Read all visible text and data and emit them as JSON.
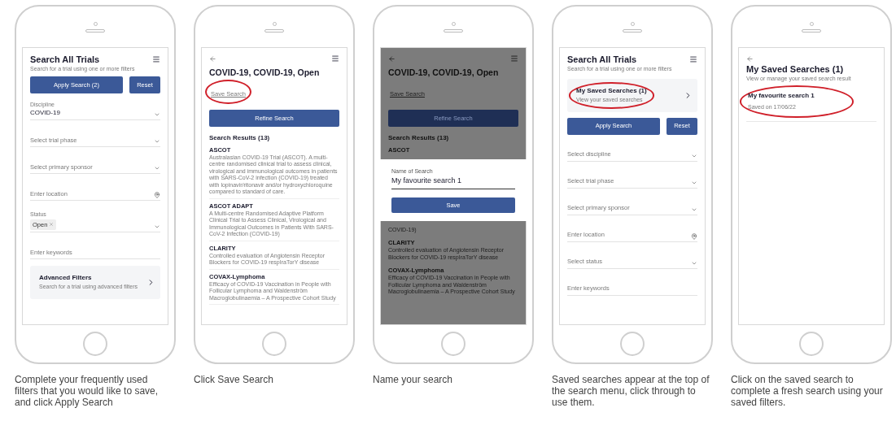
{
  "panels": [
    {
      "dimmed": false,
      "blocks": [
        {
          "kind": "header",
          "title": "Search All Trials",
          "subtitle": "Search for a trial using one or more filters",
          "menu": true
        },
        {
          "kind": "buttons",
          "primary": "Apply Search (2)",
          "secondary": "Reset"
        },
        {
          "kind": "select",
          "label": "Discipline",
          "value": "COVID-19"
        },
        {
          "kind": "select",
          "placeholder": "Select trial phase"
        },
        {
          "kind": "select",
          "placeholder": "Select primary sponsor"
        },
        {
          "kind": "location",
          "placeholder": "Enter location"
        },
        {
          "kind": "chips",
          "label": "Status",
          "chips": [
            "Open"
          ]
        },
        {
          "kind": "input",
          "placeholder": "Enter keywords"
        },
        {
          "kind": "nav_card",
          "title": "Advanced Filters",
          "subtitle": "Search for a trial using advanced filters",
          "circled": false
        }
      ],
      "caption": "Complete your frequently used filters that you would like to save, and click Apply Search"
    },
    {
      "dimmed": false,
      "blocks": [
        {
          "kind": "topbar",
          "menu": true
        },
        {
          "kind": "page_title",
          "title": "COVID-19, COVID-19, Open",
          "link": "Save Search",
          "circled": true
        },
        {
          "kind": "wide_button",
          "label": "Refine Search"
        },
        {
          "kind": "section",
          "label": "Search Results (13)"
        },
        {
          "kind": "result",
          "title": "ASCOT",
          "description": "Australasian COVID-19 Trial (ASCOT). A multi-centre randomised clinical trial to assess clinical, virological and immunological outcomes in patients with SARS-CoV-2 infection (COVID-19) treated with lopinavir/ritonavir and/or hydroxychloroquine compared to standard of care."
        },
        {
          "kind": "result",
          "title": "ASCOT ADAPT",
          "description": "A Multi-centre Randomised Adaptive Platform Clinical Trial to Assess Clinical, Virological and Immunological Outcomes in Patients With SARS-CoV-2 Infection (COVID-19)"
        },
        {
          "kind": "result",
          "title": "CLARITY",
          "description": "Controlled evaluation of Angiotensin Receptor Blockers for COVID-19 respIraTorY disease"
        },
        {
          "kind": "result",
          "title": "COVAX-Lymphoma",
          "description": "Efficacy of COVID-19 Vaccination in People with Follicular Lymphoma and Waldenström Macroglobulinaemia – A Prospective Cohort Study"
        }
      ],
      "caption": "Click Save Search"
    },
    {
      "dimmed": true,
      "blocks": [
        {
          "kind": "topbar",
          "menu": true
        },
        {
          "kind": "page_title",
          "title": "COVID-19, COVID-19, Open",
          "link": "Save Search",
          "circled": false
        },
        {
          "kind": "wide_button",
          "label": "Refine Search"
        },
        {
          "kind": "section",
          "label": "Search Results (13)"
        },
        {
          "kind": "result",
          "title": "ASCOT"
        },
        {
          "kind": "dialog",
          "label": "Name of Search",
          "value": "My favourite search 1",
          "button": "Save"
        },
        {
          "kind": "result",
          "description": "COVID-19)"
        },
        {
          "kind": "result",
          "title": "CLARITY",
          "description": "Controlled evaluation of Angiotensin Receptor Blockers for COVID-19 respIraTorY disease"
        },
        {
          "kind": "result",
          "title": "COVAX-Lymphoma",
          "description": "Efficacy of COVID-19 Vaccination in People with Follicular Lymphoma and Waldenström Macroglobulinaemia – A Prospective Cohort Study"
        }
      ],
      "caption": "Name your search"
    },
    {
      "dimmed": false,
      "blocks": [
        {
          "kind": "header",
          "title": "Search All Trials",
          "subtitle": "Search for a trial using one or more filters",
          "menu": true
        },
        {
          "kind": "nav_card",
          "title": "My Saved Searches (1)",
          "subtitle": "View your saved searches",
          "circled": true
        },
        {
          "kind": "buttons",
          "primary": "Apply Search",
          "secondary": "Reset"
        },
        {
          "kind": "select",
          "placeholder": "Select discipline"
        },
        {
          "kind": "select",
          "placeholder": "Select trial phase"
        },
        {
          "kind": "select",
          "placeholder": "Select primary sponsor"
        },
        {
          "kind": "location",
          "placeholder": "Enter location"
        },
        {
          "kind": "select",
          "placeholder": "Select status"
        },
        {
          "kind": "input",
          "placeholder": "Enter keywords"
        }
      ],
      "caption": "Saved searches appear at the top of the search menu, click through to use them."
    },
    {
      "dimmed": false,
      "blocks": [
        {
          "kind": "topbar",
          "menu": false
        },
        {
          "kind": "header",
          "title": "My Saved Searches (1)",
          "subtitle": "View or manage your saved search result",
          "menu": false
        },
        {
          "kind": "saved_item",
          "title": "My favourite search 1",
          "date": "Saved on 17/06/22",
          "circled": true
        }
      ],
      "caption": "Click on the saved search to complete a fresh search using your saved filters."
    }
  ]
}
